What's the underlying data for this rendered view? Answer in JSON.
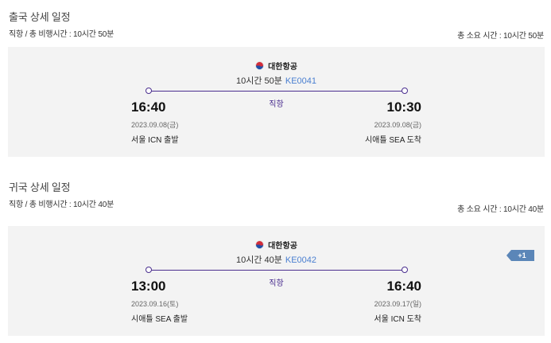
{
  "outbound": {
    "title": "출국 상세 일정",
    "summary": "직항 / 총 비행시간 : 10시간 50분",
    "total_time": "총 소요 시간 : 10시간 50분",
    "airline": "대한항공",
    "duration": "10시간 50분",
    "flight_no": "KE0041",
    "direct_label": "직항",
    "depart": {
      "time": "16:40",
      "date": "2023.09.08(금)",
      "place": "서울 ICN 출발"
    },
    "arrive": {
      "time": "10:30",
      "date": "2023.09.08(금)",
      "place": "시애틀 SEA 도착"
    }
  },
  "inbound": {
    "title": "귀국 상세 일정",
    "summary": "직항 / 총 비행시간 : 10시간 40분",
    "total_time": "총 소요 시간 : 10시간 40분",
    "airline": "대한항공",
    "duration": "10시간 40분",
    "flight_no": "KE0042",
    "direct_label": "직항",
    "day_offset_badge": "+1",
    "depart": {
      "time": "13:00",
      "date": "2023.09.16(토)",
      "place": "시애틀 SEA 출발"
    },
    "arrive": {
      "time": "16:40",
      "date": "2023.09.17(일)",
      "place": "서울 ICN 도착"
    }
  },
  "colors": {
    "card_bg": "#f3f3f3",
    "route_line": "#4b2f8f",
    "flight_no": "#4a7fd0",
    "badge": "#5b86b8"
  }
}
